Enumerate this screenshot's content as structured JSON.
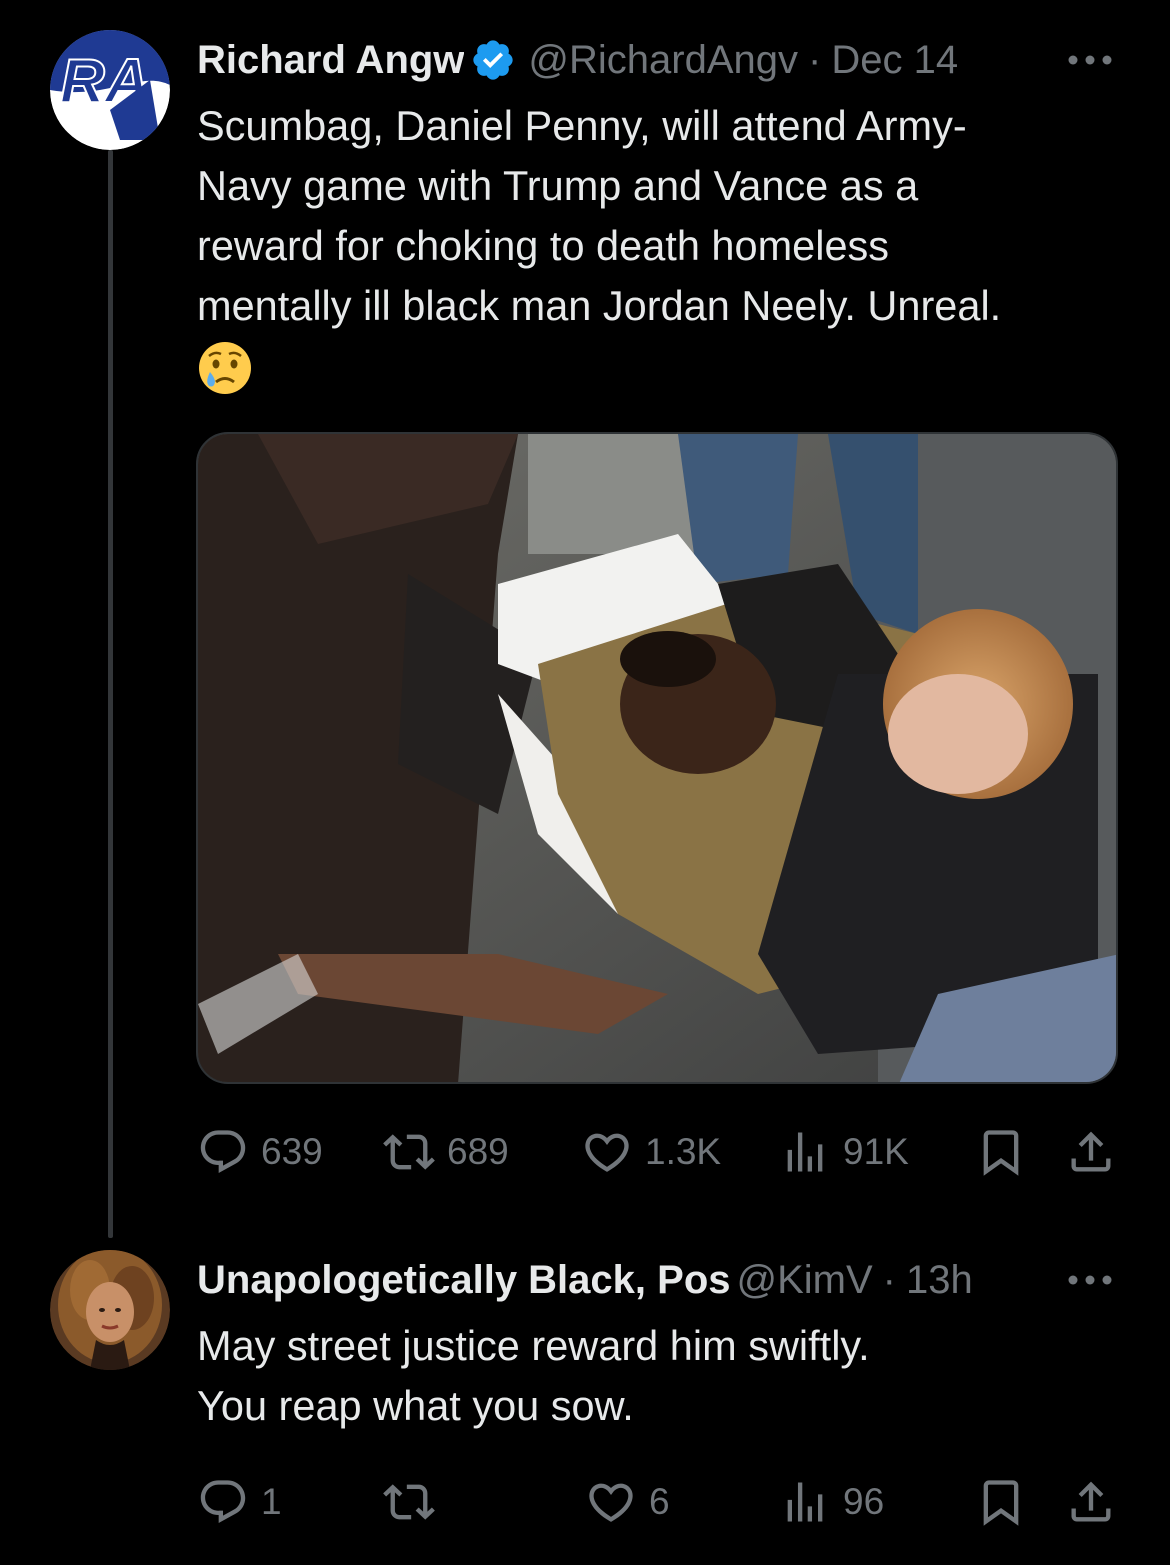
{
  "tweets": [
    {
      "author": {
        "display_name": "Richard Angw",
        "handle": "@RichardAngv",
        "verified": true,
        "avatar_initials": "RA"
      },
      "separator": "·",
      "time": "Dec 14",
      "text": "Scumbag, Daniel Penny, will attend Army-\nNavy game with Trump and Vance as a\nreward for choking to death homeless\nmentally ill black man Jordan Neely. Unreal.",
      "emoji": "crying-face",
      "has_media": true,
      "stats": {
        "replies": "639",
        "reposts": "689",
        "likes": "1.3K",
        "views": "91K"
      }
    },
    {
      "author": {
        "display_name": "Unapologetically Black, Pos",
        "handle": "@KimV",
        "verified": false
      },
      "separator": "·",
      "time": "13h",
      "text": "May street justice reward him swiftly.\nYou reap what you sow.",
      "stats": {
        "replies": "1",
        "reposts": "",
        "likes": "6",
        "views": "96"
      }
    }
  ],
  "colors": {
    "background": "#000000",
    "text_primary": "#e7e9ea",
    "text_secondary": "#71767b",
    "verified_blue": "#1d9bf0",
    "thread_line": "#333639"
  },
  "icons": [
    "reply-icon",
    "repost-icon",
    "like-icon",
    "views-icon",
    "bookmark-icon",
    "share-icon",
    "more-icon",
    "verified-badge-icon"
  ]
}
